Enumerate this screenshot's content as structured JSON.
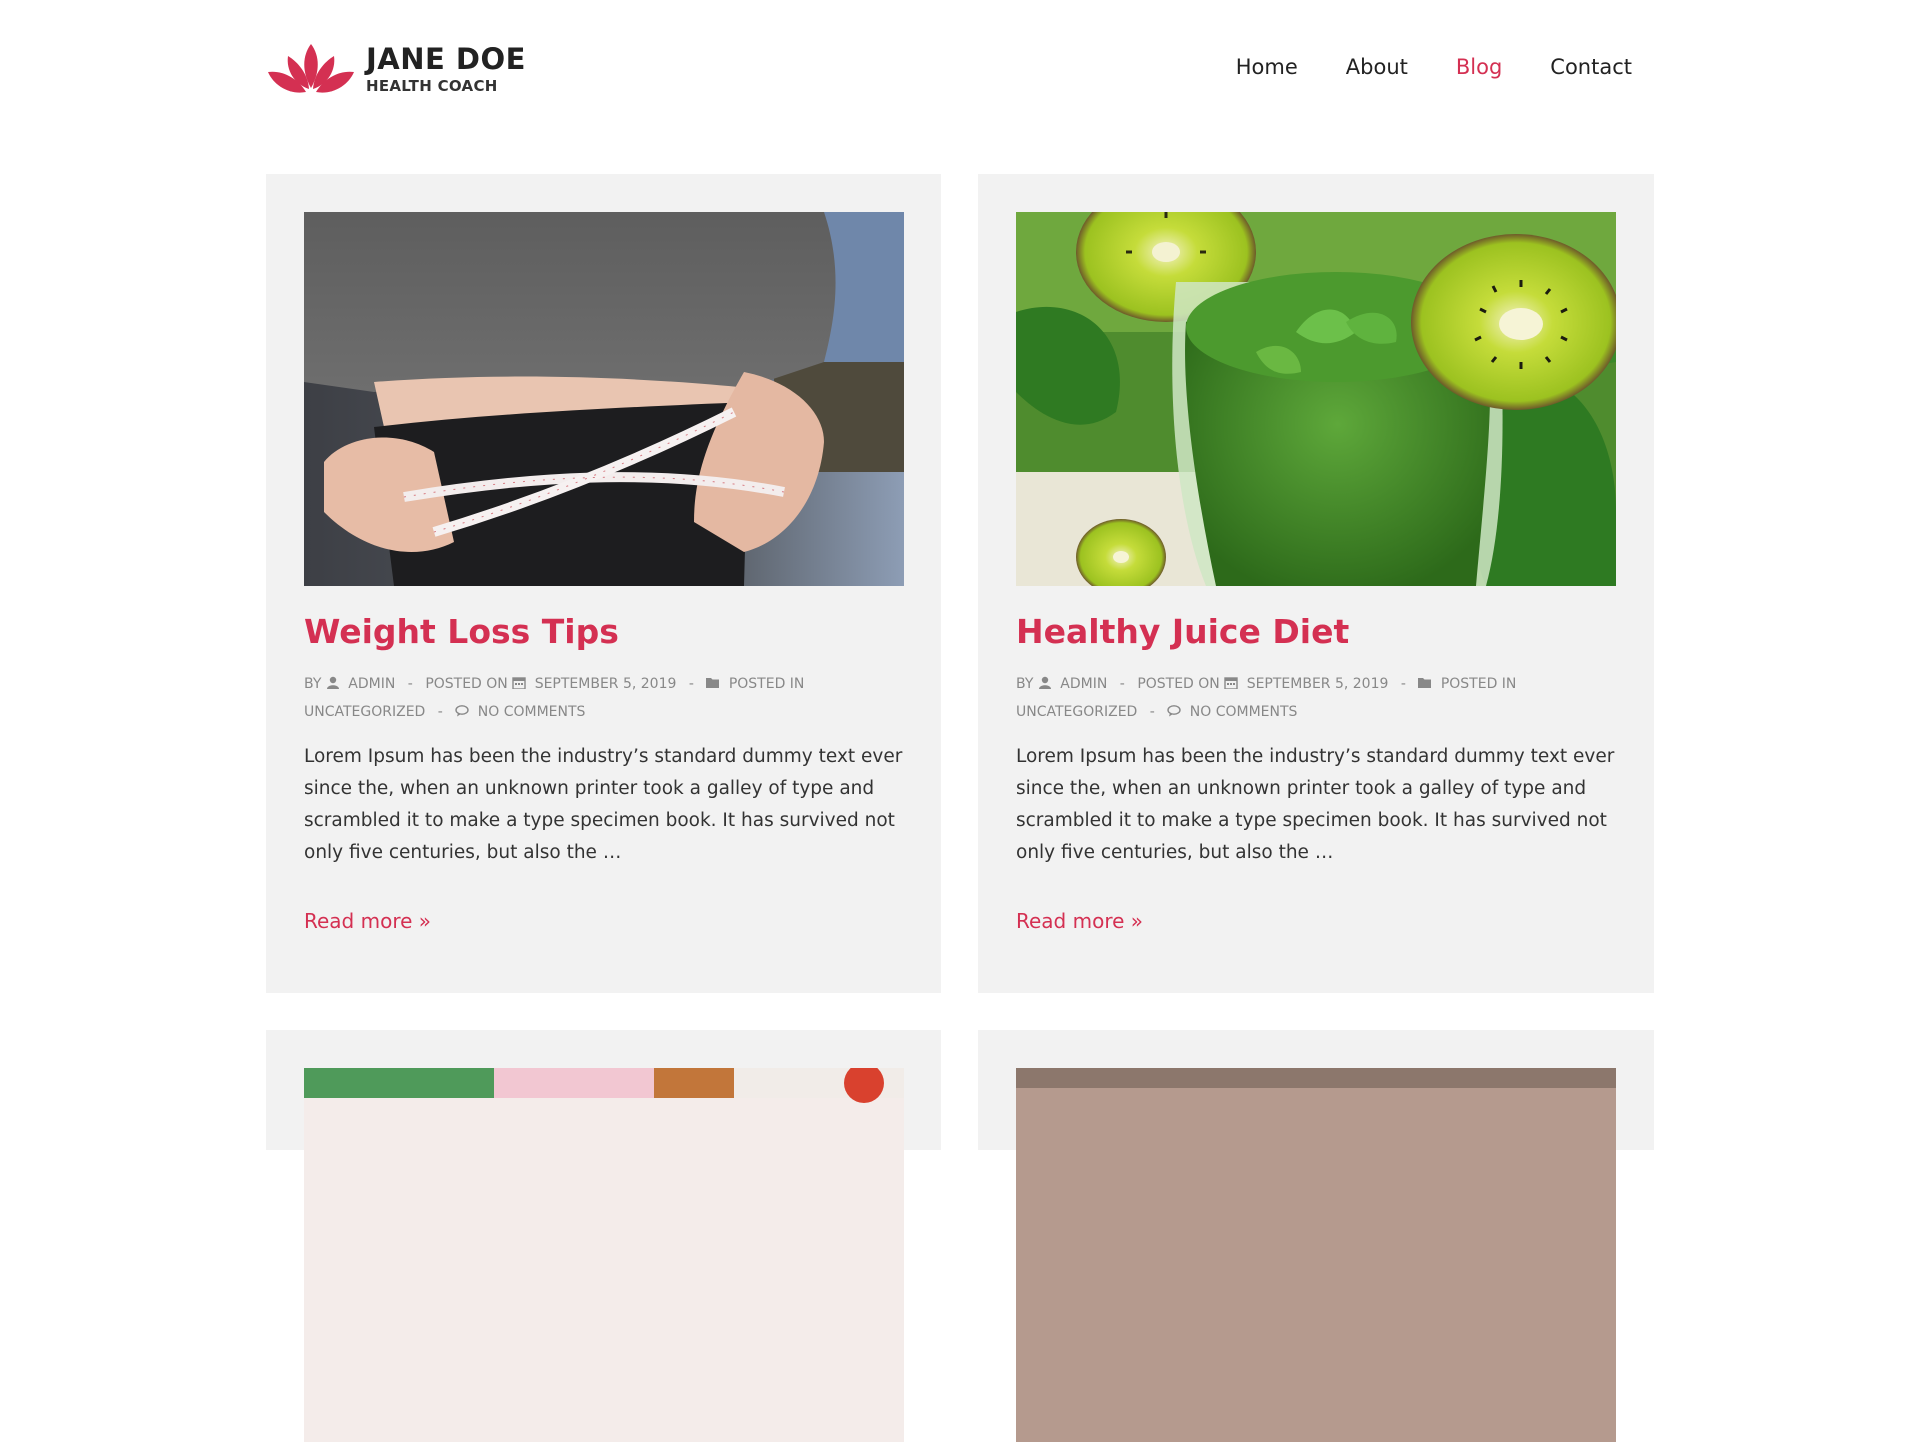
{
  "header": {
    "brand_name": "JANE DOE",
    "brand_tagline": "HEALTH COACH",
    "logo_icon": "lotus-icon",
    "brand_color": "#d43052",
    "nav": [
      {
        "label": "Home",
        "active": false
      },
      {
        "label": "About",
        "active": false
      },
      {
        "label": "Blog",
        "active": true
      },
      {
        "label": "Contact",
        "active": false
      }
    ]
  },
  "posts": [
    {
      "title": "Weight Loss Tips",
      "image_icon": "waist-measuring-tape-photo",
      "meta": {
        "by_label": "BY",
        "author": "ADMIN",
        "posted_on_label": "POSTED ON",
        "date": "SEPTEMBER 5, 2019",
        "posted_in_label": "POSTED IN",
        "category": "UNCATEGORIZED",
        "comments": "NO COMMENTS"
      },
      "excerpt": "Lorem Ipsum has been the industry’s standard dummy text ever since the, when an unknown printer took a galley of type and scrambled it to make a type specimen book. It has survived not only five centuries, but also the …",
      "read_more": "Read more »"
    },
    {
      "title": "Healthy Juice Diet",
      "image_icon": "green-juice-kiwi-photo",
      "meta": {
        "by_label": "BY",
        "author": "ADMIN",
        "posted_on_label": "POSTED ON",
        "date": "SEPTEMBER 5, 2019",
        "posted_in_label": "POSTED IN",
        "category": "UNCATEGORIZED",
        "comments": "NO COMMENTS"
      },
      "excerpt": "Lorem Ipsum has been the industry’s standard dummy text ever since the, when an unknown printer took a galley of type and scrambled it to make a type specimen book. It has survived not only five centuries, but also the …",
      "read_more": "Read more »"
    }
  ],
  "colors": {
    "accent": "#d43052",
    "card_background": "#f2f2f2",
    "meta_text": "#888888"
  }
}
